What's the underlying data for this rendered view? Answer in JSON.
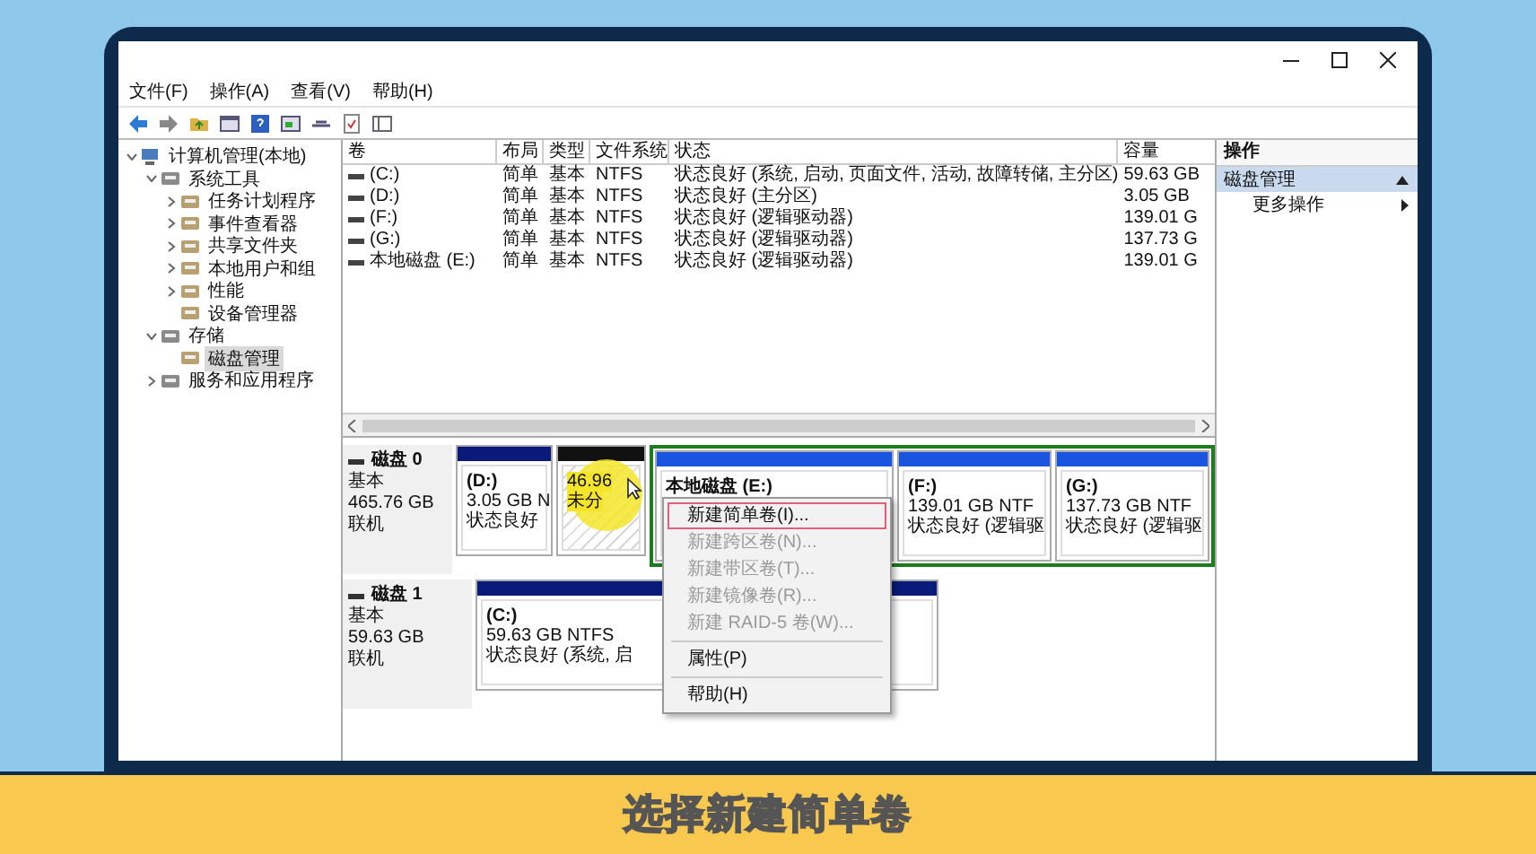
{
  "menu": [
    "文件(F)",
    "操作(A)",
    "查看(V)",
    "帮助(H)"
  ],
  "tree": [
    {
      "label": "计算机管理(本地)",
      "expanded": true,
      "selected": false,
      "children": [
        {
          "label": "系统工具",
          "expanded": true,
          "selected": false,
          "children": [
            {
              "label": "任务计划程序",
              "expanded": false,
              "selected": false
            },
            {
              "label": "事件查看器",
              "expanded": false,
              "selected": false
            },
            {
              "label": "共享文件夹",
              "expanded": false,
              "selected": false
            },
            {
              "label": "本地用户和组",
              "expanded": false,
              "selected": false
            },
            {
              "label": "性能",
              "expanded": false,
              "selected": false
            },
            {
              "label": "设备管理器",
              "selected": false
            }
          ]
        },
        {
          "label": "存储",
          "expanded": true,
          "selected": false,
          "children": [
            {
              "label": "磁盘管理",
              "selected": true
            }
          ]
        },
        {
          "label": "服务和应用程序",
          "expanded": false,
          "selected": false
        }
      ]
    }
  ],
  "table": {
    "columns": [
      "卷",
      "布局",
      "类型",
      "文件系统",
      "状态",
      "容量"
    ],
    "rows": [
      [
        "(C:)",
        "简单",
        "基本",
        "NTFS",
        "状态良好 (系统, 启动, 页面文件, 活动, 故障转储, 主分区)",
        "59.63 GB"
      ],
      [
        "(D:)",
        "简单",
        "基本",
        "NTFS",
        "状态良好 (主分区)",
        "3.05 GB"
      ],
      [
        "(F:)",
        "简单",
        "基本",
        "NTFS",
        "状态良好 (逻辑驱动器)",
        "139.01 G"
      ],
      [
        "(G:)",
        "简单",
        "基本",
        "NTFS",
        "状态良好 (逻辑驱动器)",
        "137.73 G"
      ],
      [
        "本地磁盘 (E:)",
        "简单",
        "基本",
        "NTFS",
        "状态良好 (逻辑驱动器)",
        "139.01 G"
      ]
    ]
  },
  "disks": [
    {
      "name": "磁盘 0",
      "type": "基本",
      "size": "465.76 GB",
      "status": "联机",
      "partitions": [
        {
          "kind": "primary",
          "label": "(D:)",
          "size": "3.05 GB N",
          "status": "状态良好"
        },
        {
          "kind": "unallocated",
          "size": "46.96",
          "status": "未分"
        },
        {
          "kind": "logical",
          "label": "本地磁盘 (E:)"
        },
        {
          "kind": "logical",
          "label": "(F:)",
          "size": "139.01 GB NTF",
          "status": "状态良好 (逻辑驱"
        },
        {
          "kind": "logical",
          "label": "(G:)",
          "size": "137.73 GB NTF",
          "status": "状态良好 (逻辑驱"
        }
      ]
    },
    {
      "name": "磁盘 1",
      "type": "基本",
      "size": "59.63 GB",
      "status": "联机",
      "partitions": [
        {
          "kind": "primary",
          "label": "(C:)",
          "size": "59.63 GB NTFS",
          "status": "状态良好 (系统, 启"
        },
        {
          "kind": "primary"
        }
      ]
    }
  ],
  "context_menu": [
    [
      {
        "label": "新建简单卷(I)...",
        "disabled": false,
        "selected": true
      },
      {
        "label": "新建跨区卷(N)...",
        "disabled": true,
        "selected": false
      },
      {
        "label": "新建带区卷(T)...",
        "disabled": true,
        "selected": false
      },
      {
        "label": "新建镜像卷(R)...",
        "disabled": true,
        "selected": false
      },
      {
        "label": "新建 RAID-5 卷(W)...",
        "disabled": true,
        "selected": false
      }
    ],
    [
      {
        "label": "属性(P)",
        "disabled": false,
        "selected": false
      }
    ],
    [
      {
        "label": "帮助(H)",
        "disabled": false,
        "selected": false
      }
    ]
  ],
  "actions": {
    "title": "操作",
    "sections": [
      {
        "label": "磁盘管理",
        "expanded": true,
        "items": [
          "更多操作"
        ]
      }
    ]
  },
  "subtitle": "选择新建简单卷"
}
